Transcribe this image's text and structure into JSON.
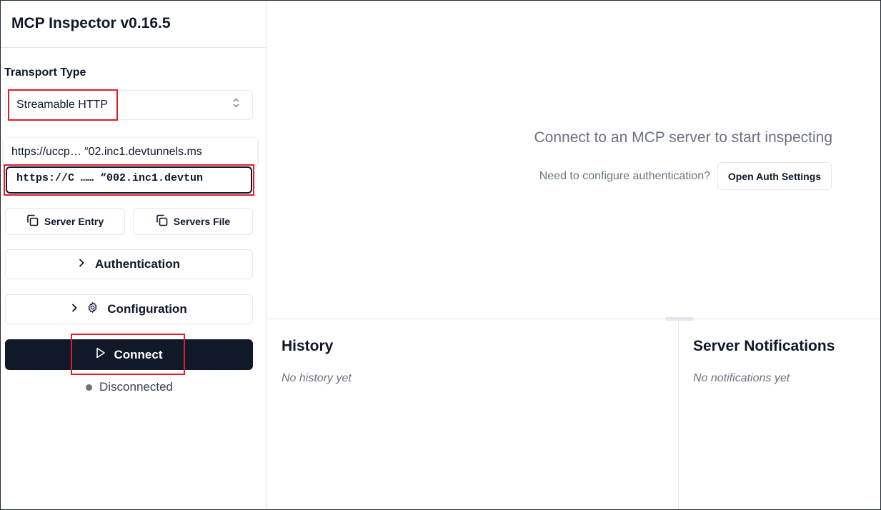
{
  "app": {
    "title": "MCP Inspector v0.16.5"
  },
  "sidebar": {
    "transport_label": "Transport Type",
    "transport_value": "Streamable HTTP",
    "url_suggestion": "https://uccp… “02.inc1.devtunnels.ms",
    "url_value": "https://C …… “002.inc1.devtun",
    "server_entry_label": "Server Entry",
    "servers_file_label": "Servers File",
    "authentication_label": "Authentication",
    "configuration_label": "Configuration",
    "connect_label": "Connect",
    "status_text": "Disconnected"
  },
  "main": {
    "connect_message": "Connect to an MCP server to start inspecting",
    "auth_question": "Need to configure authentication?",
    "open_auth_label": "Open Auth Settings"
  },
  "history": {
    "title": "History",
    "empty": "No history yet"
  },
  "notifications": {
    "title": "Server Notifications",
    "empty": "No notifications yet"
  },
  "colors": {
    "highlight": "#e11d2a",
    "primary": "#111827",
    "muted": "#6b7280"
  },
  "icons": [
    "chevron-up-down-icon",
    "copy-icon",
    "chevron-right-icon",
    "gear-icon",
    "play-icon"
  ]
}
